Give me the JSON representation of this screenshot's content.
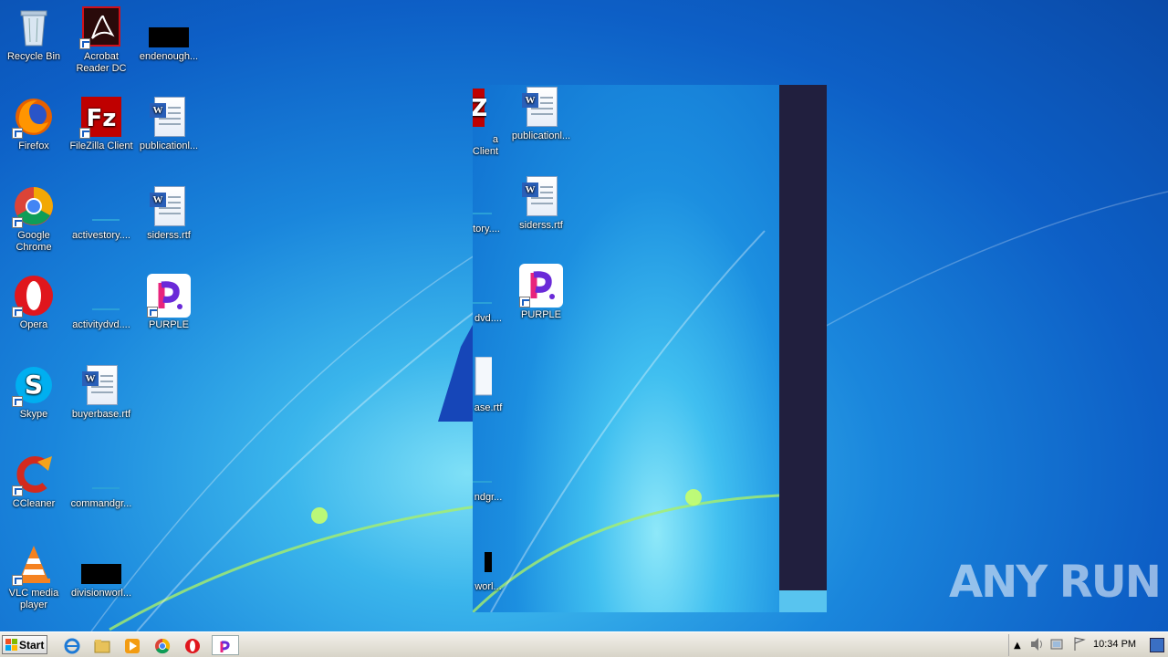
{
  "desktop": {
    "icons": {
      "recycle_bin": "Recycle Bin",
      "acrobat": "Acrobat Reader DC",
      "endenough": "endenough...",
      "firefox": "Firefox",
      "filezilla": "FileZilla Client",
      "publication": "publicationl...",
      "chrome": "Google Chrome",
      "activestory": "activestory....",
      "siderss": "siderss.rtf",
      "opera": "Opera",
      "activitydvd": "activitydvd....",
      "purple": "PURPLE",
      "skype": "Skype",
      "buyerbase": "buyerbase.rtf",
      "ccleaner": "CCleaner",
      "commandgr": "commandgr...",
      "vlc": "VLC media player",
      "divisionworl": "divisionworl..."
    },
    "ghost_icons": {
      "filezilla_frag": "a Client",
      "publication": "publicationl...",
      "activestory_frag": "tory....",
      "siderss": "siderss.rtf",
      "activitydvd_frag": "dvd....",
      "purple": "PURPLE",
      "buyerbase_frag": "ase.rtf",
      "commandgr_frag": "ndgr...",
      "divisionworl_frag": "worl..."
    }
  },
  "taskbar": {
    "start_label": "Start",
    "clock": "10:34 PM",
    "pinned": [
      "internet-explorer-icon",
      "explorer-icon",
      "media-player-icon",
      "chrome-icon",
      "opera-icon",
      "purple-icon"
    ]
  },
  "watermark": "ANY RUN",
  "colors": {
    "taskbar": "#e4e1d8",
    "dark_panel": "#211f3e",
    "desktop_blue": "#1a86dc"
  }
}
